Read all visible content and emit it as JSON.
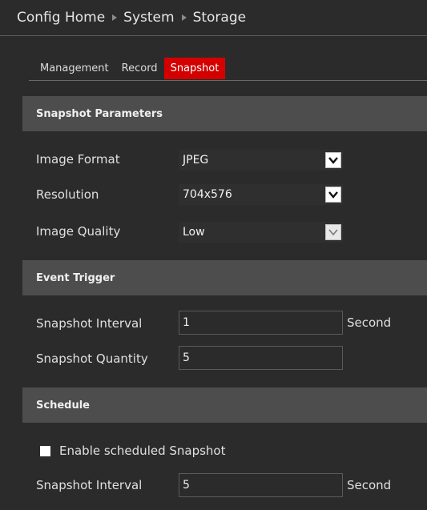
{
  "breadcrumb": {
    "items": [
      "Config Home",
      "System",
      "Storage"
    ]
  },
  "tabs": [
    {
      "label": "Management",
      "active": false
    },
    {
      "label": "Record",
      "active": false
    },
    {
      "label": "Snapshot",
      "active": true
    }
  ],
  "snapshot_parameters": {
    "title": "Snapshot Parameters",
    "image_format": {
      "label": "Image Format",
      "value": "JPEG"
    },
    "resolution": {
      "label": "Resolution",
      "value": "704x576"
    },
    "image_quality": {
      "label": "Image Quality",
      "value": "Low"
    }
  },
  "event_trigger": {
    "title": "Event Trigger",
    "interval": {
      "label": "Snapshot Interval",
      "value": "1",
      "unit": "Second"
    },
    "quantity": {
      "label": "Snapshot Quantity",
      "value": "5"
    }
  },
  "schedule": {
    "title": "Schedule",
    "enable": {
      "label": "Enable scheduled Snapshot",
      "checked": false
    },
    "interval": {
      "label": "Snapshot Interval",
      "value": "5",
      "unit": "Second"
    }
  },
  "colors": {
    "background": "#2b2b2b",
    "section_header": "#4d4d4d",
    "active_tab": "#d40000"
  },
  "icons": {
    "breadcrumb_separator": "triangle-right-icon",
    "dropdown": "chevron-down-icon"
  }
}
